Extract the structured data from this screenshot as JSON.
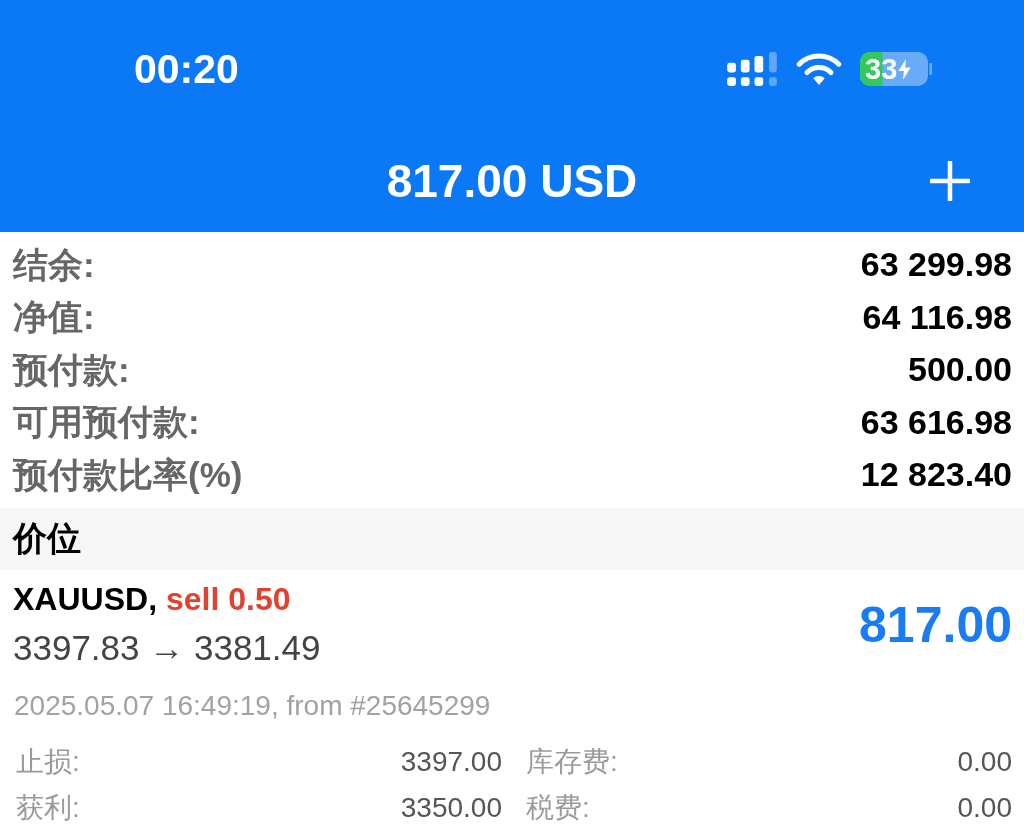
{
  "status_bar": {
    "time": "00:20",
    "battery": {
      "percent": "33",
      "charging": true
    }
  },
  "header": {
    "title": "817.00 USD"
  },
  "summary": [
    {
      "label": "结余:",
      "value": "63 299.98"
    },
    {
      "label": "净值:",
      "value": "64 116.98"
    },
    {
      "label": "预付款:",
      "value": "500.00"
    },
    {
      "label": "可用预付款:",
      "value": "63 616.98"
    },
    {
      "label": "预付款比率(%)",
      "value": "12 823.40"
    }
  ],
  "section": {
    "title": "价位"
  },
  "positions": [
    {
      "symbol": "XAUUSD,",
      "order": "sell 0.50",
      "kind": "sell",
      "prices": "3397.83 → 3381.49",
      "profit": "817.00",
      "opened": "2025.05.07 16:49:19, from #25645299",
      "details": [
        {
          "label": "止损:",
          "value": "3397.00"
        },
        {
          "label": "库存费:",
          "value": "0.00"
        },
        {
          "label": "获利:",
          "value": "3350.00"
        },
        {
          "label": "税费:",
          "value": "0.00"
        }
      ]
    }
  ]
}
